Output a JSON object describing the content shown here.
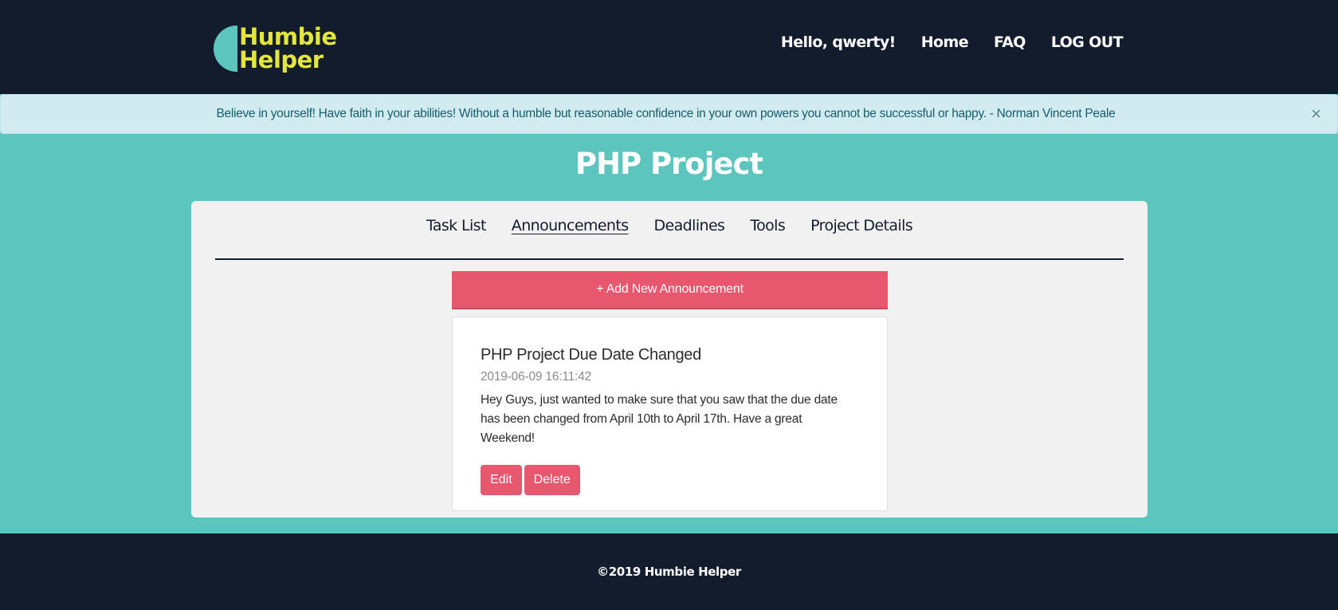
{
  "brand": {
    "line1": "Humbie",
    "line2": "Helper",
    "logo_icon": "half-circle-logo-icon"
  },
  "nav": {
    "greeting": "Hello, qwerty!",
    "links": [
      {
        "label": "Home"
      },
      {
        "label": "FAQ"
      },
      {
        "label": "LOG OUT"
      }
    ]
  },
  "alert": {
    "text": "Believe in yourself! Have faith in your abilities! Without a humble but reasonable confidence in your own powers you cannot be successful or happy. - Norman Vincent Peale",
    "close_symbol": "×",
    "close_icon": "close-icon"
  },
  "page": {
    "title": "PHP Project"
  },
  "tabs": [
    {
      "label": "Task List",
      "active": false
    },
    {
      "label": "Announcements",
      "active": true
    },
    {
      "label": "Deadlines",
      "active": false
    },
    {
      "label": "Tools",
      "active": false
    },
    {
      "label": "Project Details",
      "active": false
    }
  ],
  "announcements": {
    "add_label": "+ Add New Announcement",
    "items": [
      {
        "title": "PHP Project Due Date Changed",
        "timestamp": "2019-06-09 16:11:42",
        "body": "Hey Guys, just wanted to make sure that you saw that the due date has been changed from April 10th to April 17th. Have a great Weekend!",
        "edit_label": "Edit",
        "delete_label": "Delete"
      }
    ]
  },
  "footer": {
    "text": "©2019 Humbie Helper"
  },
  "colors": {
    "navbar": "#121c2d",
    "accent_teal": "#5bc5be",
    "logo_yellow": "#e3e63c",
    "button_pink": "#e7586f",
    "alert_bg": "#d2ebf1",
    "panel_bg": "#f1f1f1"
  }
}
